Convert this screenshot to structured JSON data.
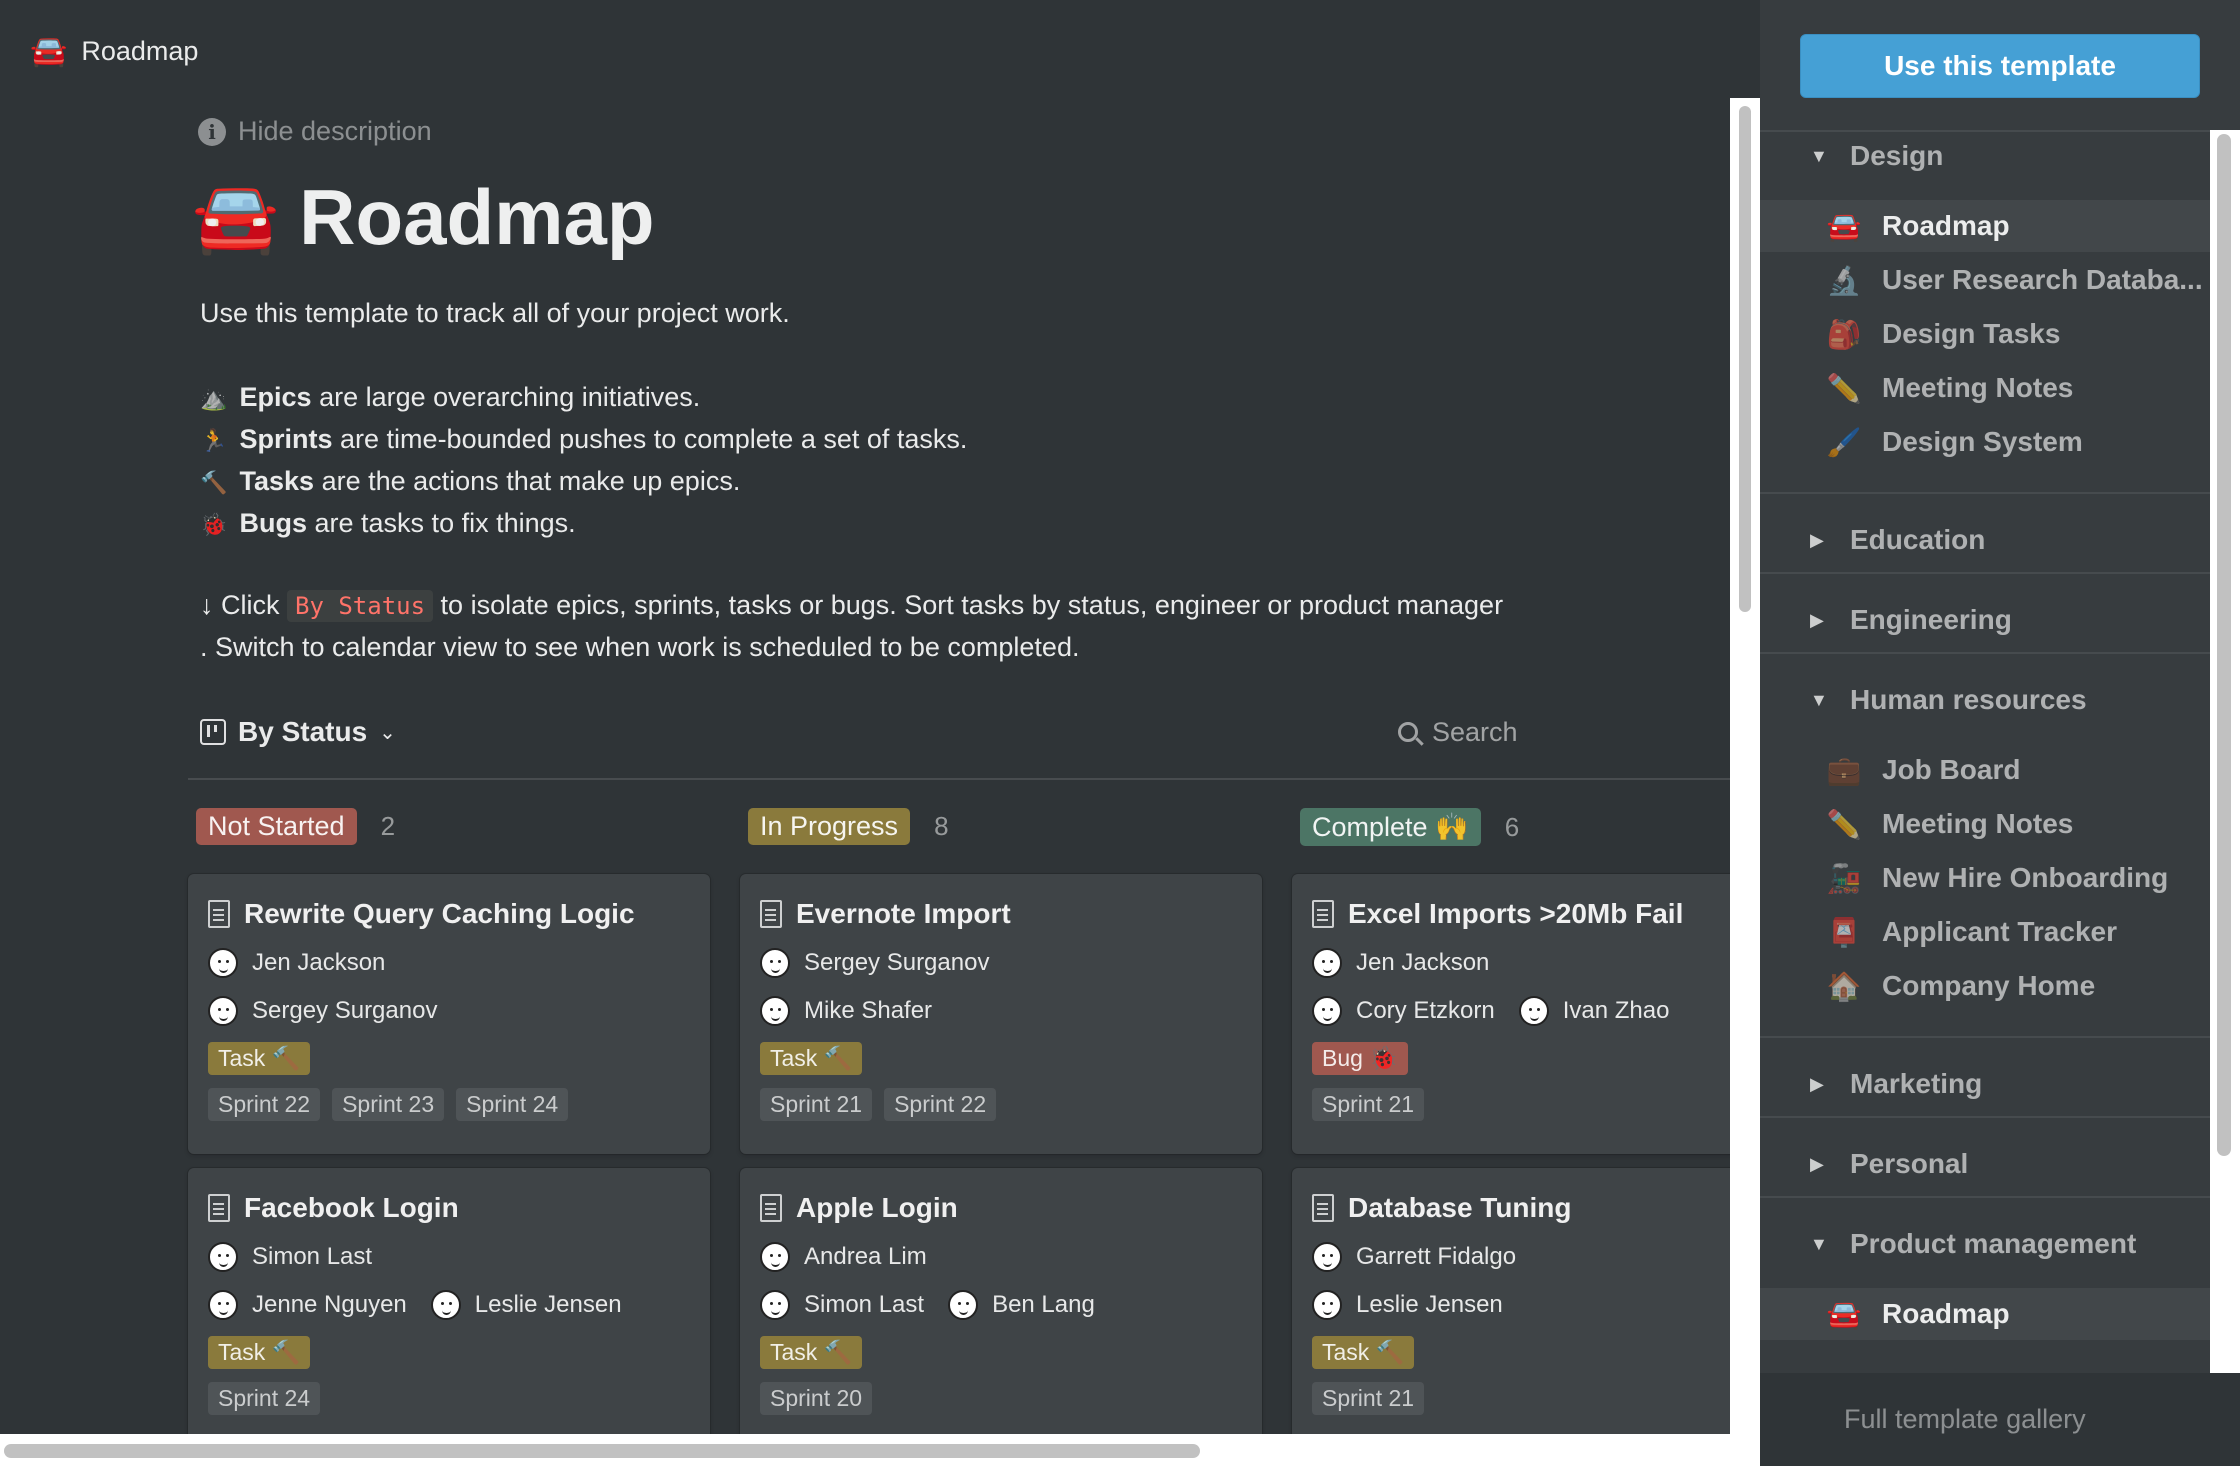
{
  "topbar": {
    "emoji": "🚘",
    "title": "Roadmap"
  },
  "hide_description": "Hide description",
  "page": {
    "emoji": "🚘",
    "title": "Roadmap"
  },
  "description": {
    "intro": "Use this template to track all of your project work.",
    "bullets": [
      {
        "emoji": "⛰️",
        "term": "Epics",
        "rest": " are large overarching initiatives."
      },
      {
        "emoji": "🏃",
        "term": "Sprints",
        "rest": " are time-bounded pushes to complete a set of tasks."
      },
      {
        "emoji": "🔨",
        "term": "Tasks",
        "rest": " are the actions that make up epics."
      },
      {
        "emoji": "🐞",
        "term": "Bugs",
        "rest": " are tasks to fix things."
      }
    ],
    "hint_before": "↓ Click ",
    "hint_code": "By Status",
    "hint_after": " to isolate epics, sprints, tasks or bugs. Sort tasks by status, engineer or product manager",
    "hint_line2": ". Switch to calendar view to see when work is scheduled to be completed."
  },
  "view": {
    "label": "By Status",
    "chevron": "⌄"
  },
  "search": {
    "label": "Search"
  },
  "columns": [
    {
      "label": "Not Started",
      "count": "2",
      "color": "#a0584f"
    },
    {
      "label": "In Progress",
      "count": "8",
      "color": "#8a7a3c"
    },
    {
      "label": "Complete 🙌",
      "count": "6",
      "color": "#4c7565"
    }
  ],
  "tag_colors": {
    "Task": "#8a7a3c",
    "Bug": "#a0584f"
  },
  "cards": [
    {
      "title": "Rewrite Query Caching Logic",
      "people_rows": [
        [
          "Jen Jackson"
        ],
        [
          "Sergey Surganov"
        ]
      ],
      "type": "Task 🔨",
      "type_kind": "Task",
      "sprints": [
        "Sprint 22",
        "Sprint 23",
        "Sprint 24"
      ]
    },
    {
      "title": "Evernote Import",
      "people_rows": [
        [
          "Sergey Surganov"
        ],
        [
          "Mike Shafer"
        ]
      ],
      "type": "Task 🔨",
      "type_kind": "Task",
      "sprints": [
        "Sprint 21",
        "Sprint 22"
      ]
    },
    {
      "title": "Excel Imports >20Mb Fail",
      "people_rows": [
        [
          "Jen Jackson"
        ],
        [
          "Cory Etzkorn",
          "Ivan Zhao"
        ]
      ],
      "type": "Bug 🐞",
      "type_kind": "Bug",
      "sprints": [
        "Sprint 21"
      ]
    },
    {
      "title": "Facebook Login",
      "people_rows": [
        [
          "Simon Last"
        ],
        [
          "Jenne Nguyen",
          "Leslie Jensen"
        ]
      ],
      "type": "Task 🔨",
      "type_kind": "Task",
      "sprints": [
        "Sprint 24"
      ]
    },
    {
      "title": "Apple Login",
      "people_rows": [
        [
          "Andrea Lim"
        ],
        [
          "Simon Last",
          "Ben Lang"
        ]
      ],
      "type": "Task 🔨",
      "type_kind": "Task",
      "sprints": [
        "Sprint 20"
      ]
    },
    {
      "title": "Database Tuning",
      "people_rows": [
        [
          "Garrett Fidalgo"
        ],
        [
          "Leslie Jensen"
        ]
      ],
      "type": "Task 🔨",
      "type_kind": "Task",
      "sprints": [
        "Sprint 21"
      ]
    }
  ],
  "sidebar": {
    "use_template": "Use this template",
    "sections": [
      {
        "name": "Design",
        "expanded": true,
        "items": [
          {
            "emoji": "🚘",
            "label": "Roadmap",
            "active": true
          },
          {
            "emoji": "🔬",
            "label": "User Research Databa..."
          },
          {
            "emoji": "🎒",
            "label": "Design Tasks"
          },
          {
            "emoji": "✏️",
            "label": "Meeting Notes"
          },
          {
            "emoji": "🖌️",
            "label": "Design System"
          }
        ]
      },
      {
        "name": "Education",
        "expanded": false,
        "items": []
      },
      {
        "name": "Engineering",
        "expanded": false,
        "items": []
      },
      {
        "name": "Human resources",
        "expanded": true,
        "items": [
          {
            "emoji": "💼",
            "label": "Job Board"
          },
          {
            "emoji": "✏️",
            "label": "Meeting Notes"
          },
          {
            "emoji": "🚂",
            "label": "New Hire Onboarding"
          },
          {
            "emoji": "📮",
            "label": "Applicant Tracker"
          },
          {
            "emoji": "🏠",
            "label": "Company Home"
          }
        ]
      },
      {
        "name": "Marketing",
        "expanded": false,
        "items": []
      },
      {
        "name": "Personal",
        "expanded": false,
        "items": []
      },
      {
        "name": "Product management",
        "expanded": true,
        "items": [
          {
            "emoji": "🚘",
            "label": "Roadmap",
            "active": true
          }
        ]
      }
    ],
    "gallery": "Full template gallery",
    "expanded_glyph": "▼",
    "collapsed_glyph": "▶"
  }
}
